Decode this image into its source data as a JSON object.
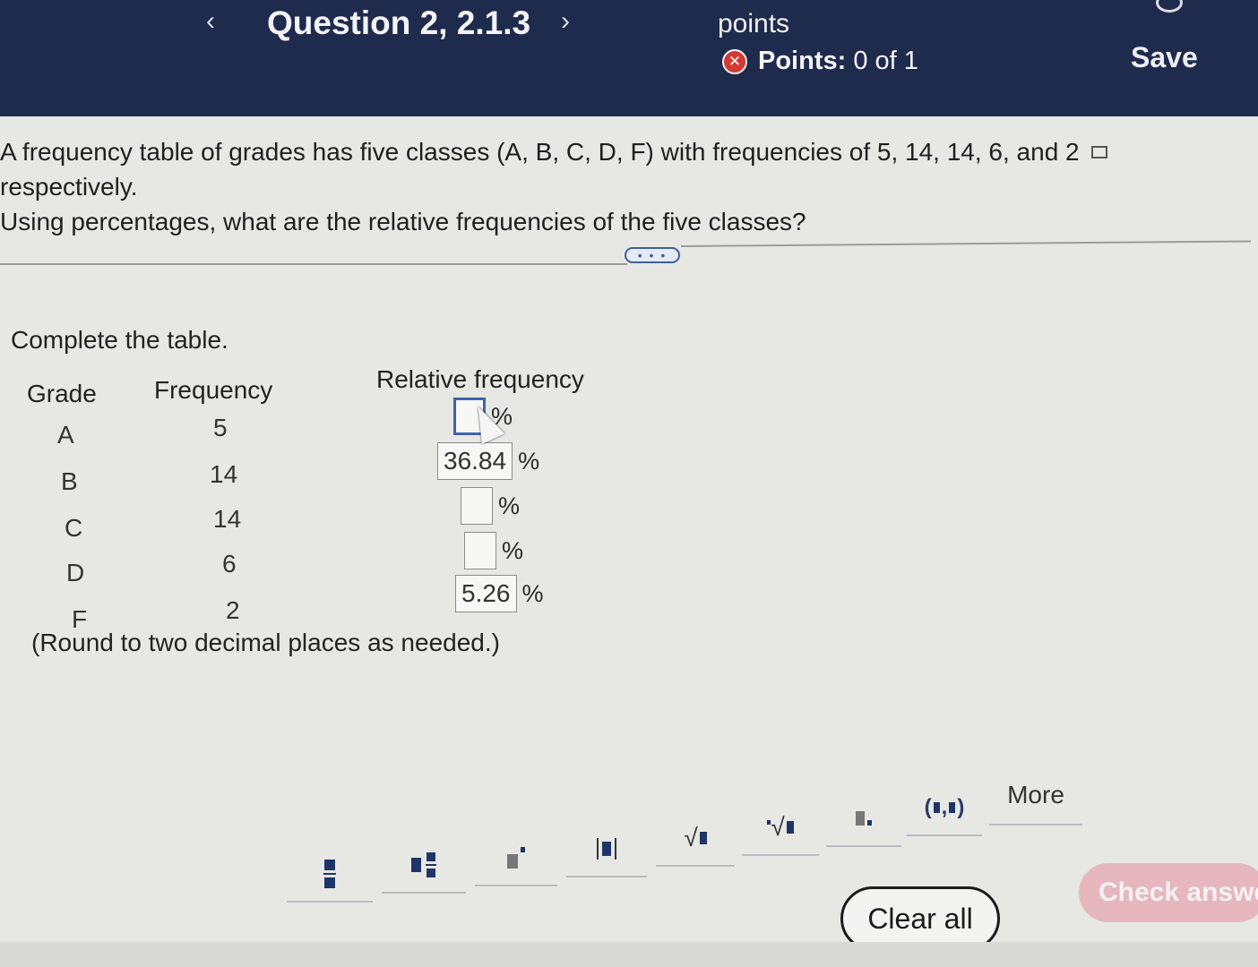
{
  "header": {
    "prev_icon": "chevron-left-icon",
    "title": "Question 2, 2.1.3",
    "next_icon": "chevron-right-icon",
    "points_label": "points",
    "points_status_icon": "incorrect-x-icon",
    "points_prefix": "Points:",
    "points_value": "0 of 1",
    "save_label": "Save",
    "colors": {
      "bar": "#1f2b4d",
      "incorrect": "#d23a33"
    }
  },
  "question": {
    "line1": "A frequency table of grades has five classes (A, B, C, D, F) with frequencies of 5, 14, 14, 6, and 2",
    "line1_end": "respectively.",
    "line2": "Using percentages, what are the relative frequencies of the five classes?",
    "copy_icon": "copy-icon",
    "expand_label": "• • •"
  },
  "table": {
    "instruction": "Complete the table.",
    "headers": {
      "grade": "Grade",
      "frequency": "Frequency",
      "relative": "Relative frequency"
    },
    "rows": [
      {
        "grade": "A",
        "frequency": "5",
        "answer": "",
        "unit": "%"
      },
      {
        "grade": "B",
        "frequency": "14",
        "answer": "36.84",
        "unit": "%"
      },
      {
        "grade": "C",
        "frequency": "14",
        "answer": "",
        "unit": "%"
      },
      {
        "grade": "D",
        "frequency": "6",
        "answer": "",
        "unit": "%"
      },
      {
        "grade": "F",
        "frequency": "2",
        "answer": "5.26",
        "unit": "%"
      }
    ],
    "note": "(Round to two decimal places as needed.)"
  },
  "toolbar": {
    "tools": [
      {
        "name": "fraction-tool",
        "icon": "fraction-icon"
      },
      {
        "name": "mixed-number-tool",
        "icon": "mixed-number-icon"
      },
      {
        "name": "exponent-tool",
        "icon": "exponent-icon"
      },
      {
        "name": "absolute-value-tool",
        "icon": "absolute-value-icon"
      },
      {
        "name": "square-root-tool",
        "icon": "square-root-icon"
      },
      {
        "name": "nth-root-tool",
        "icon": "nth-root-icon"
      },
      {
        "name": "subscript-tool",
        "icon": "subscript-icon"
      },
      {
        "name": "ordered-pair-tool",
        "icon": "ordered-pair-icon"
      }
    ],
    "more_label": "More",
    "clear_label": "Clear all",
    "check_label": "Check answe"
  }
}
